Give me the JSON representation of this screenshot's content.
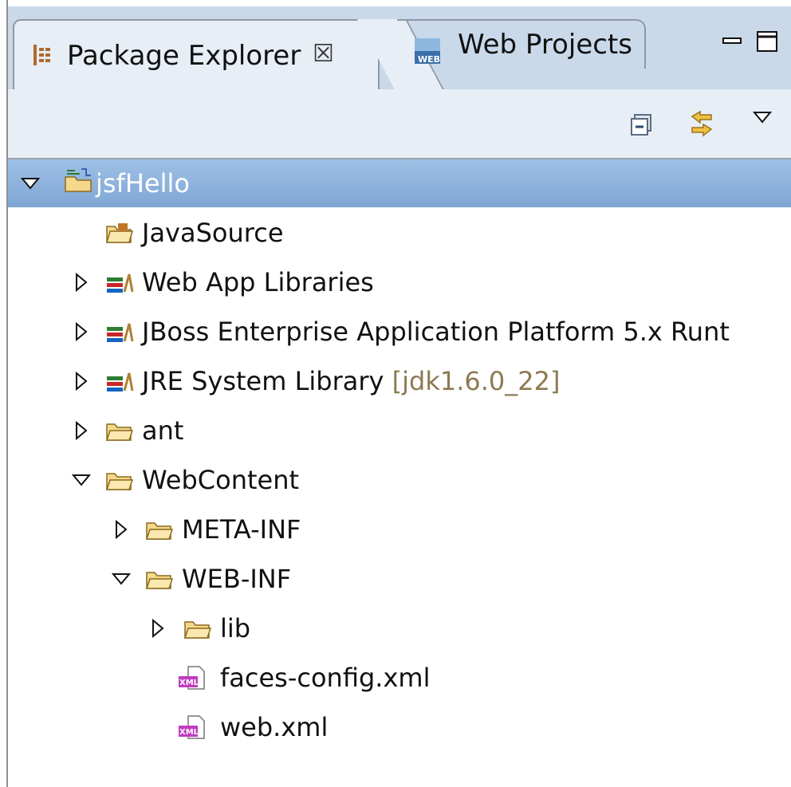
{
  "tabs": [
    {
      "label": "Package Explorer",
      "icon": "package-explorer-icon",
      "close": "☒",
      "active": true
    },
    {
      "label": "Web Projects",
      "icon": "web-projects-icon",
      "active": false
    }
  ],
  "window_buttons": [
    "minimize",
    "maximize"
  ],
  "toolbar": [
    "collapse-all",
    "link-with-editor",
    "view-menu"
  ],
  "tree": [
    {
      "label": "jsfHello",
      "icon": "project-icon",
      "twisty": "expanded",
      "selected": true
    },
    {
      "label": "JavaSource",
      "icon": "source-folder-icon",
      "twisty": "none"
    },
    {
      "label": "Web App Libraries",
      "icon": "library-icon",
      "twisty": "collapsed"
    },
    {
      "label": "JBoss Enterprise Application Platform 5.x Runt",
      "icon": "library-icon",
      "twisty": "collapsed"
    },
    {
      "label": "JRE System Library",
      "decoration": "[jdk1.6.0_22]",
      "icon": "library-icon",
      "twisty": "collapsed"
    },
    {
      "label": "ant",
      "icon": "folder-icon",
      "twisty": "collapsed"
    },
    {
      "label": "WebContent",
      "icon": "folder-icon",
      "twisty": "expanded"
    },
    {
      "label": "META-INF",
      "icon": "folder-icon",
      "twisty": "collapsed"
    },
    {
      "label": "WEB-INF",
      "icon": "folder-icon",
      "twisty": "expanded"
    },
    {
      "label": "lib",
      "icon": "folder-icon",
      "twisty": "collapsed"
    },
    {
      "label": "faces-config.xml",
      "icon": "xml-file-icon",
      "twisty": "none"
    },
    {
      "label": "web.xml",
      "icon": "xml-file-icon",
      "twisty": "none"
    }
  ],
  "colors": {
    "selection": "#7fa6d4",
    "decoration": "#8c7a52",
    "tabbar": "#c9d9ea"
  }
}
